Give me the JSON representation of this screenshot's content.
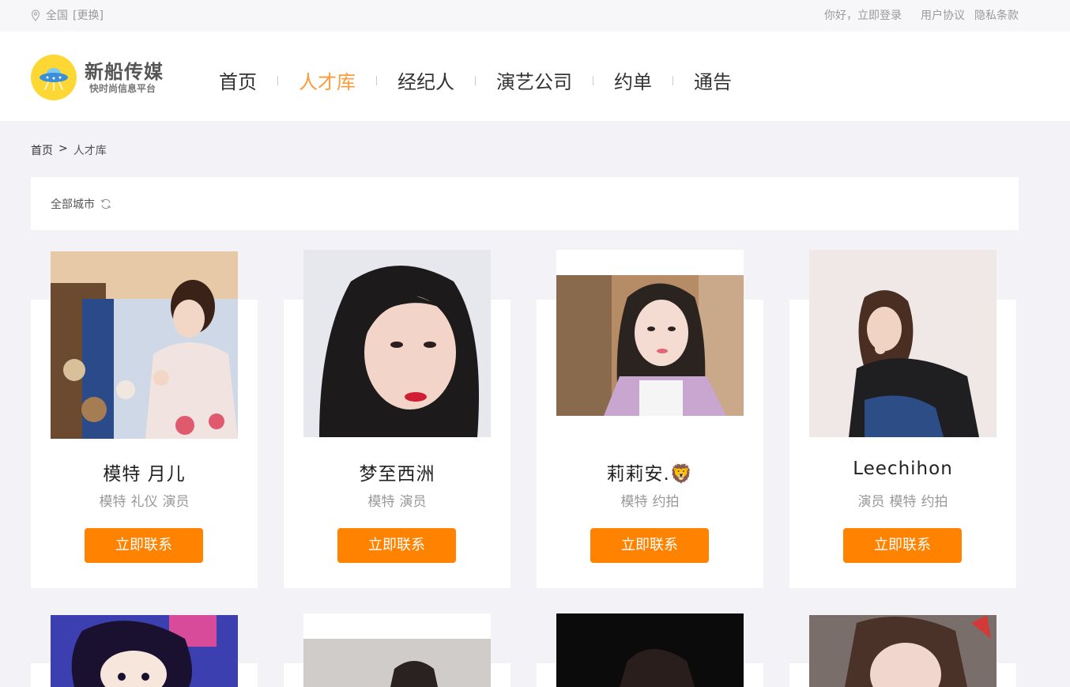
{
  "topbar": {
    "location": "全国",
    "change": "[更换]",
    "login": "你好，立即登录",
    "agreement": "用户协议",
    "privacy": "隐私条款"
  },
  "logo": {
    "name": "新船传媒",
    "slogan": "快时尚信息平台"
  },
  "nav": [
    {
      "label": "首页",
      "active": false
    },
    {
      "label": "人才库",
      "active": true
    },
    {
      "label": "经纪人",
      "active": false
    },
    {
      "label": "演艺公司",
      "active": false
    },
    {
      "label": "约单",
      "active": false
    },
    {
      "label": "通告",
      "active": false
    }
  ],
  "breadcrumb": {
    "home": "首页",
    "sep": ">",
    "current": "人才库"
  },
  "filter": {
    "city_label": "全部城市"
  },
  "cards": [
    {
      "name": "模特 月儿",
      "tags": [
        "模特",
        "礼仪",
        "演员"
      ],
      "button": "立即联系"
    },
    {
      "name": "梦至西洲",
      "tags": [
        "模特",
        "演员"
      ],
      "button": "立即联系"
    },
    {
      "name": "莉莉安.🦁",
      "tags": [
        "模特",
        "约拍"
      ],
      "button": "立即联系"
    },
    {
      "name": "Leechihon",
      "tags": [
        "演员",
        "模特",
        "约拍"
      ],
      "button": "立即联系"
    }
  ],
  "colors": {
    "accent": "#ff8200",
    "active_nav": "#ff9a3c",
    "page_bg": "#f2f2f7"
  }
}
